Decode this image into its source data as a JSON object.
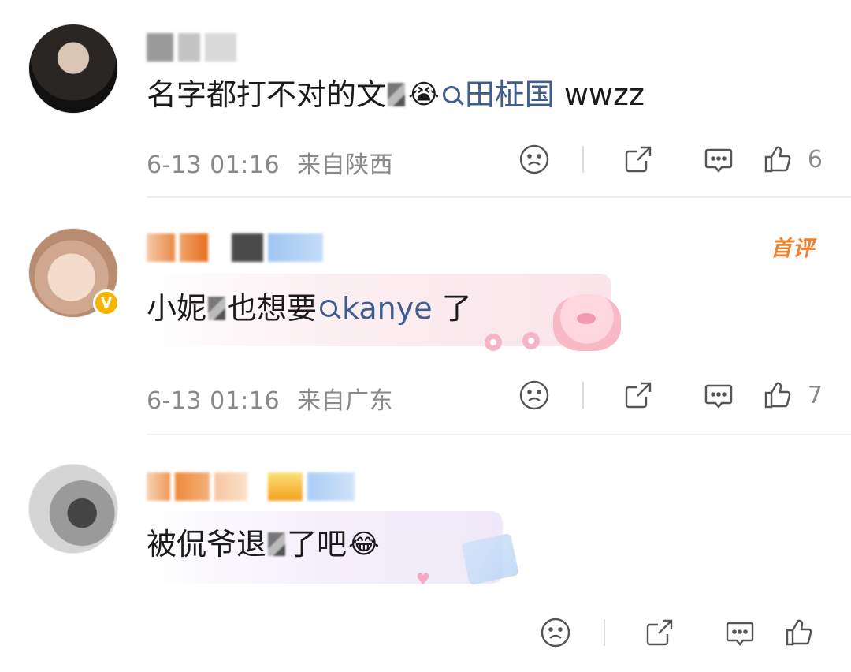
{
  "comments": [
    {
      "text_before_censor": "名字都打不对的文",
      "emoji": "😭",
      "topic": "田柾国",
      "text_after": " wwzz",
      "date": "6-13 01:16",
      "location": "来自陕西",
      "likes": "6"
    },
    {
      "first_badge": "首评",
      "verified": "V",
      "text_before_censor": "小妮",
      "text_after_censor": "也想要",
      "topic": "kanye",
      "text_after": " 了",
      "date": "6-13 01:16",
      "location": "来自广东",
      "likes": "7"
    },
    {
      "text_before_censor": "被侃爷退",
      "text_after_censor": "了吧",
      "emoji": "😂"
    }
  ],
  "icons": {
    "dislike": "sad-face-icon",
    "share": "share-icon",
    "reply": "comment-icon",
    "like": "thumbs-up-icon"
  },
  "colors": {
    "topic_link": "#3f5e8f",
    "meta_text": "#8a8a8a",
    "first_badge": "#f2812c",
    "verified_badge": "#f7b500"
  }
}
